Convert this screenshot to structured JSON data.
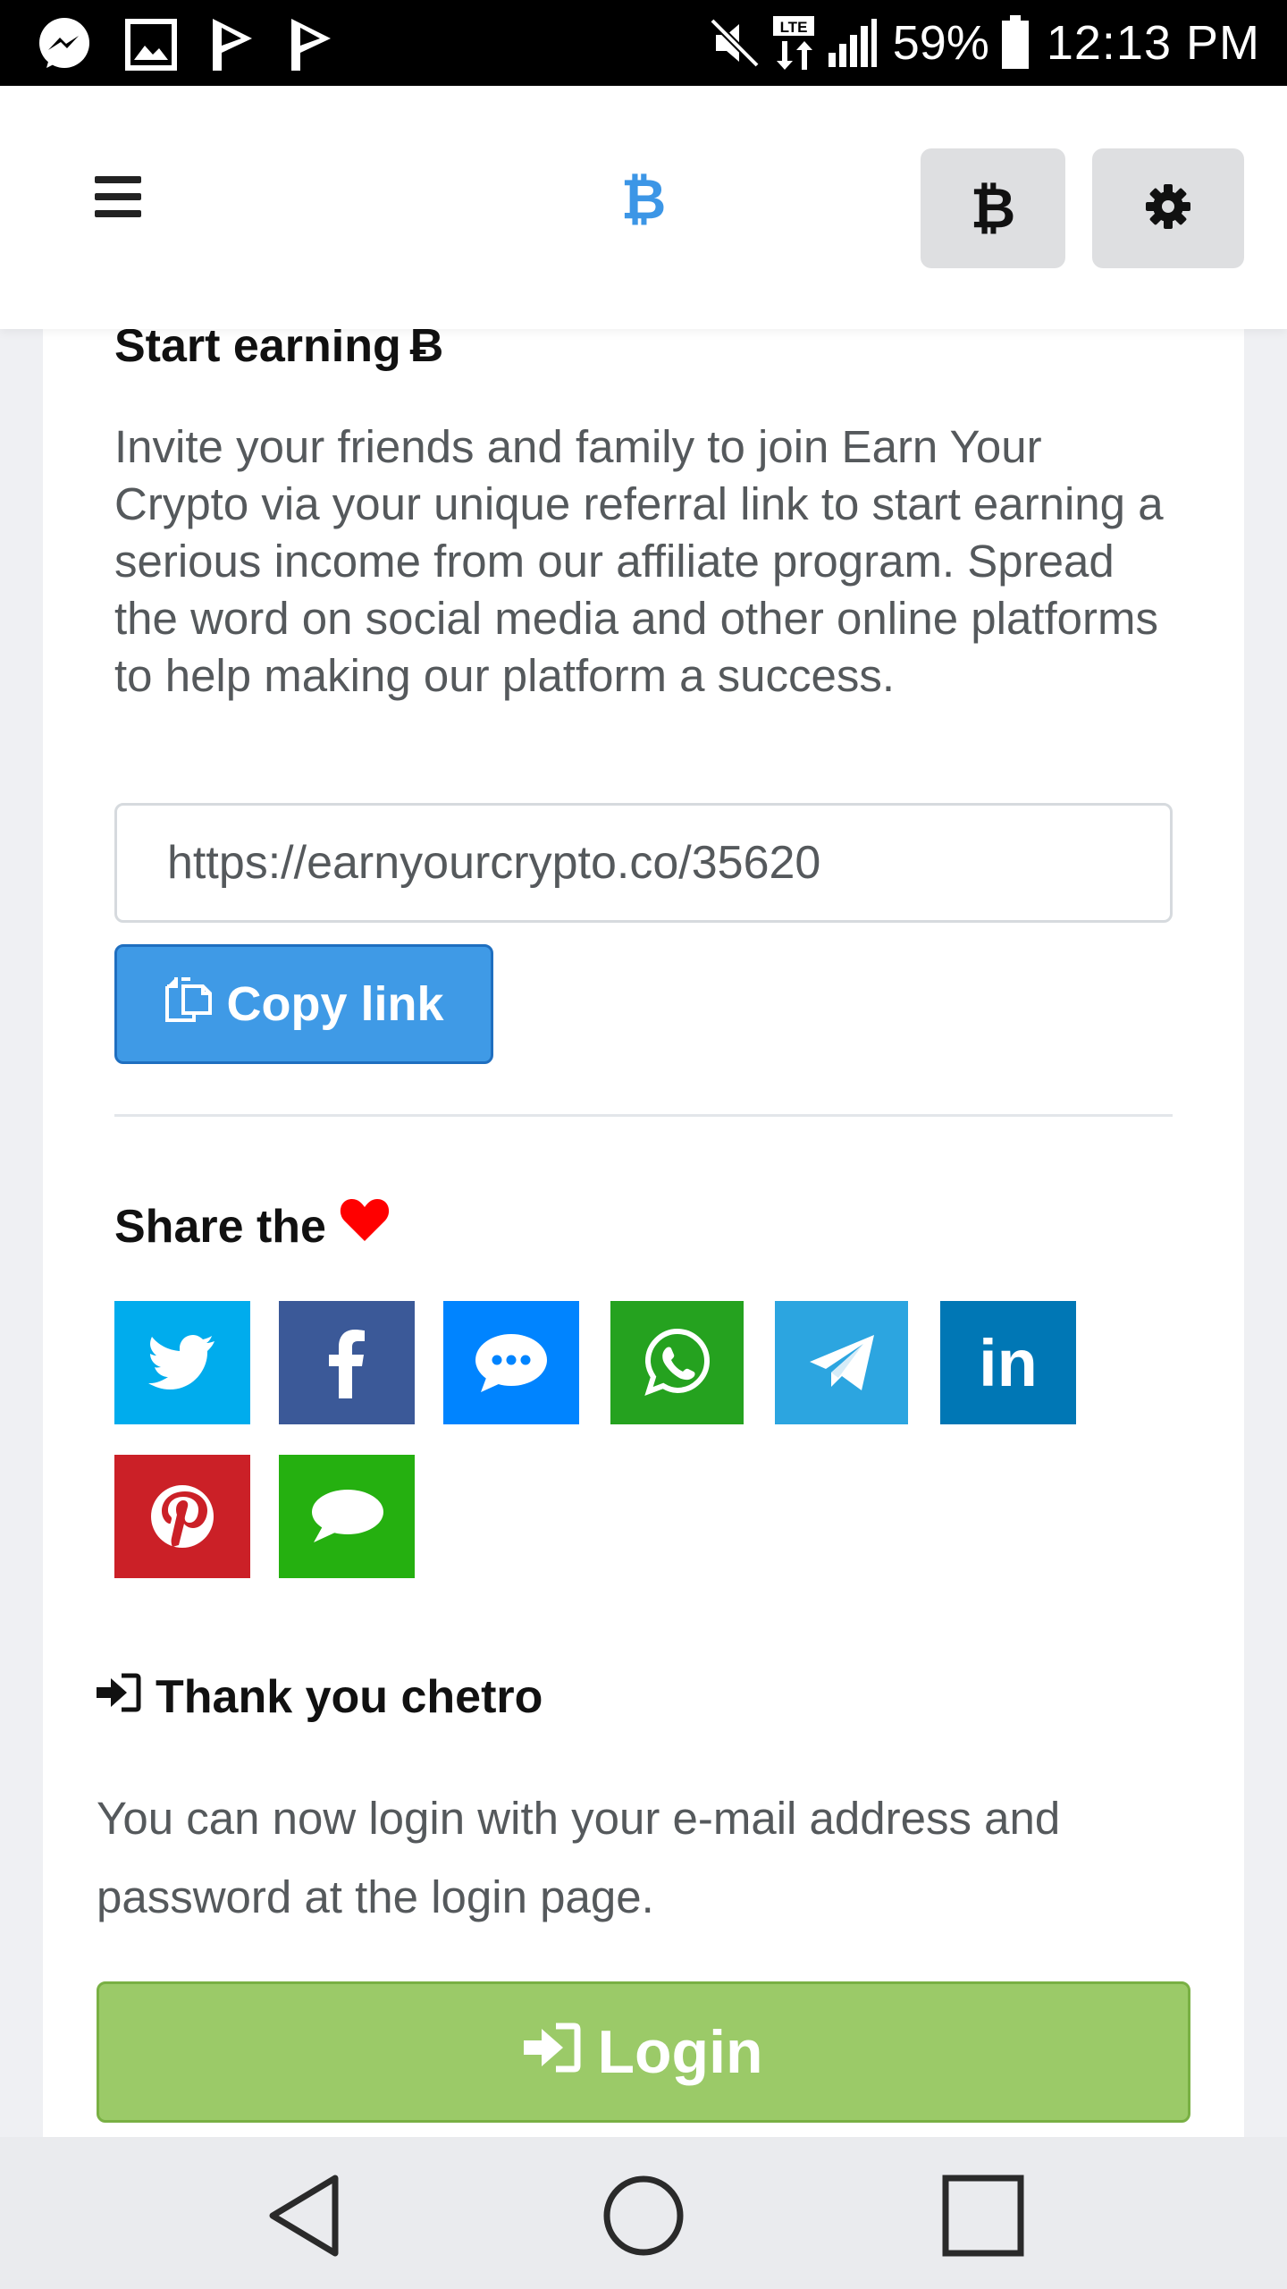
{
  "status_bar": {
    "battery": "59%",
    "time": "12:13 PM",
    "network": "LTE",
    "notification_icons": [
      "messenger-icon",
      "gallery-icon",
      "play-icon",
      "play-icon"
    ],
    "system_icons": [
      "mute-icon",
      "lte-icon",
      "signal-icon",
      "battery-icon"
    ]
  },
  "top_nav": {
    "brand_symbol": "₿",
    "bitcoin_button_label": "₿",
    "icons": [
      "menu-icon",
      "bitcoin-icon",
      "gear-icon"
    ]
  },
  "referral": {
    "title": "Start earning",
    "title_symbol": "Ƀ",
    "description": "Invite your friends and family to join Earn Your Crypto via your unique referral link to start earning a serious income from our affiliate program. Spread the word on social media and other online platforms to help making our platform a success.",
    "link_value": "https://earnyourcrypto.co/35620",
    "copy_button_label": "Copy link"
  },
  "share": {
    "title": "Share the",
    "buttons": [
      {
        "name": "twitter",
        "color": "#00aced"
      },
      {
        "name": "facebook",
        "color": "#3b5998"
      },
      {
        "name": "messenger",
        "color": "#0084ff"
      },
      {
        "name": "whatsapp",
        "color": "#25a21f"
      },
      {
        "name": "telegram",
        "color": "#2ca5e0"
      },
      {
        "name": "linkedin",
        "color": "#0077b5",
        "label": "in"
      },
      {
        "name": "pinterest",
        "color": "#cb2027"
      },
      {
        "name": "sms",
        "color": "#25b010"
      }
    ]
  },
  "thanks": {
    "title": "Thank you chetro",
    "message": "You can now login with your e-mail address and password at the login page.",
    "login_button_label": "Login"
  },
  "colors": {
    "accent_blue": "#3f9ae6",
    "login_green": "#9bca68",
    "brand_blue": "#3c96e6",
    "heart_red": "#ff0000"
  }
}
